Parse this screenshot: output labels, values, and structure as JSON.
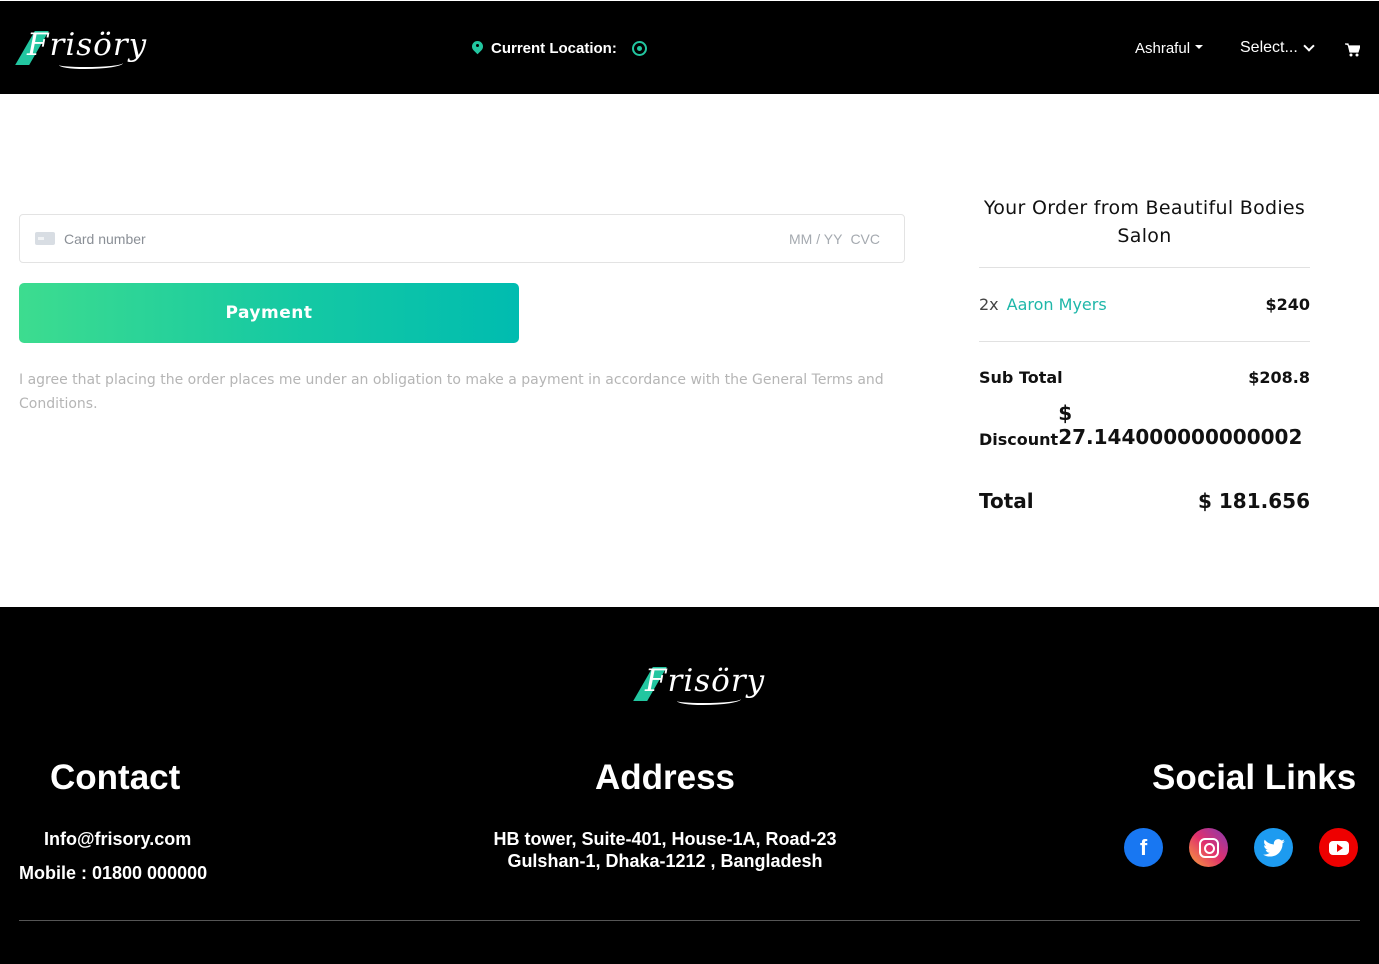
{
  "header": {
    "logo": "Frisöry",
    "location_label": "Current Location:",
    "user_name": "Ashraful",
    "select_label": "Select...",
    "icons": [
      "map-pin-icon",
      "locate-target-icon",
      "caret-down-icon",
      "chevron-down-icon",
      "cart-icon"
    ]
  },
  "payment": {
    "card_placeholder": "Card number",
    "expiry_placeholder": "MM / YY",
    "cvc_placeholder": "CVC",
    "button_label": "Payment",
    "agreement": "I agree that placing the order places me under an obligation to make a payment in accordance with the General Terms and Conditions."
  },
  "order": {
    "title": "Your Order from Beautiful Bodies Salon",
    "items": [
      {
        "qty": "2x",
        "name": "Aaron Myers",
        "price": "$240"
      }
    ],
    "subtotal_label": "Sub Total",
    "subtotal_value": "$208.8",
    "discount_label": "Discount",
    "discount_value": "$ 27.144000000000002",
    "total_label": "Total",
    "total_value": "$ 181.656"
  },
  "footer": {
    "logo": "Frisöry",
    "contact_heading": "Contact",
    "email": "Info@frisory.com",
    "mobile": "Mobile : 01800 000000",
    "address_heading": "Address",
    "address_line1": "HB tower, Suite-401, House-1A, Road-23",
    "address_line2": "Gulshan-1, Dhaka-1212 , Bangladesh",
    "social_heading": "Social Links",
    "social": [
      "facebook-icon",
      "instagram-icon",
      "twitter-icon",
      "youtube-icon"
    ]
  },
  "colors": {
    "accent": "#22c6a0",
    "header_bg": "#000000",
    "link": "#1fb7a9",
    "button_gradient_start": "#3ddc8f",
    "button_gradient_end": "#00bcb0"
  }
}
